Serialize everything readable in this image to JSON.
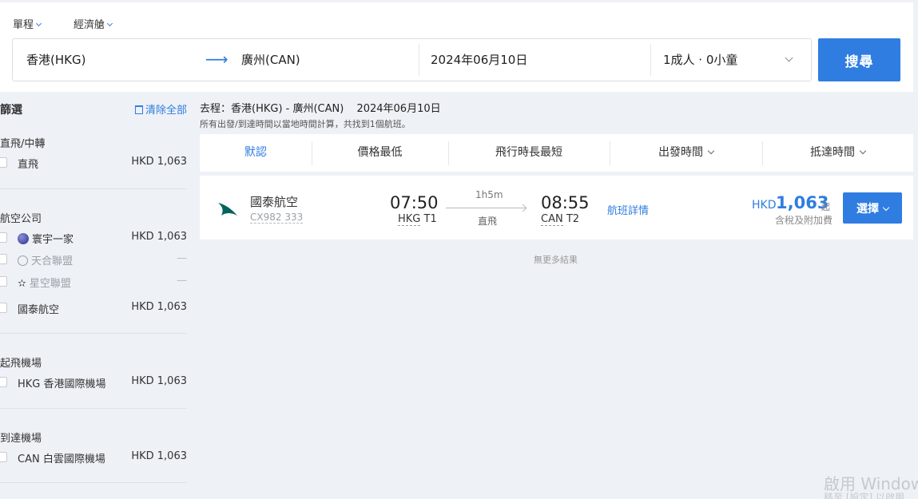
{
  "search": {
    "trip_type": "單程",
    "cabin": "經濟艙",
    "origin": "香港(HKG)",
    "destination": "廣州(CAN)",
    "date": "2024年06月10日",
    "passengers": "1成人 · 0小童",
    "search_label": "搜尋"
  },
  "filters": {
    "title": "篩選",
    "clear_all": "清除全部",
    "stops": {
      "title": "直飛/中轉",
      "options": [
        {
          "label": "直飛",
          "price": "HKD 1,063"
        }
      ]
    },
    "airlines": {
      "title": "航空公司",
      "options": [
        {
          "label": "寰宇一家",
          "price": "HKD 1,063",
          "icon": "oneworld-icon"
        },
        {
          "label": "天合聯盟",
          "price": "—",
          "icon": "skyteam-icon",
          "disabled": true
        },
        {
          "label": "星空聯盟",
          "price": "—",
          "icon": "star-alliance-icon",
          "disabled": true
        },
        {
          "label": "國泰航空",
          "price": "HKD 1,063"
        }
      ]
    },
    "departure_airports": {
      "title": "起飛機場",
      "options": [
        {
          "label": "HKG 香港國際機場",
          "price": "HKD 1,063"
        }
      ]
    },
    "arrival_airports": {
      "title": "到達機場",
      "options": [
        {
          "label": "CAN 白雲國際機場",
          "price": "HKD 1,063"
        }
      ]
    }
  },
  "results": {
    "route_label": "去程：香港(HKG) - 廣州(CAN)",
    "route_date": "2024年06月10日",
    "note": "所有出發/到達時間以當地時間計算，共找到1個航班。",
    "sort": {
      "default": "默認",
      "lowest_price": "價格最低",
      "shortest_duration": "飛行時長最短",
      "departure_time": "出發時間",
      "arrival_time": "抵達時間"
    },
    "flight": {
      "airline": "國泰航空",
      "flight_no": "CX982 333",
      "dep_time": "07:50",
      "dep_airport": "HKG",
      "dep_terminal": "T1",
      "duration": "1h5m",
      "stops": "直飛",
      "arr_time": "08:55",
      "arr_airport": "CAN",
      "arr_terminal": "T2",
      "details": "航班詳情",
      "currency": "HKD",
      "price": "1,063",
      "price_suffix": "起",
      "tax_note": "含稅及附加費",
      "select_label": "選擇"
    },
    "no_more": "無更多結果"
  },
  "watermark": {
    "line1": "啟用 Windows",
    "line2": "移至 [設定] 以啟用"
  },
  "colors": {
    "accent": "#2f7de1",
    "background": "#eef1f6"
  }
}
